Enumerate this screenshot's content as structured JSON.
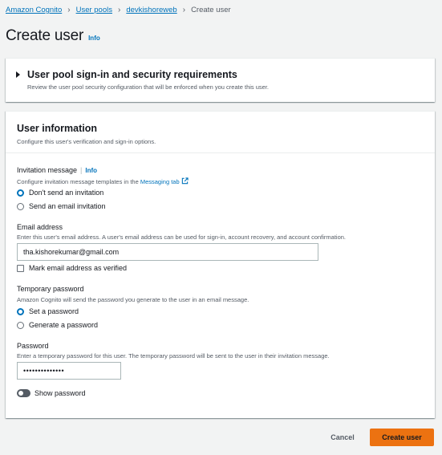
{
  "breadcrumb": {
    "items": [
      "Amazon Cognito",
      "User pools",
      "devkishoreweb"
    ],
    "current": "Create user"
  },
  "page": {
    "title": "Create user",
    "info": "Info"
  },
  "security_section": {
    "title": "User pool sign-in and security requirements",
    "description": "Review the user pool security configuration that will be enforced when you create this user."
  },
  "user_info": {
    "title": "User information",
    "description": "Configure this user's verification and sign-in options.",
    "invitation": {
      "label": "Invitation message",
      "info": "Info",
      "desc_prefix": "Configure invitation message templates in the ",
      "desc_link": "Messaging tab",
      "options": [
        "Don't send an invitation",
        "Send an email invitation"
      ],
      "selected": 0
    },
    "email": {
      "label": "Email address",
      "desc": "Enter this user's email address. A user's email address can be used for sign-in, account recovery, and account confirmation.",
      "value": "tha.kishorekumar@gmail.com",
      "verified_label": "Mark email address as verified",
      "verified_checked": false
    },
    "temp_password": {
      "label": "Temporary password",
      "desc": "Amazon Cognito will send the password you generate to the user in an email message.",
      "options": [
        "Set a password",
        "Generate a password"
      ],
      "selected": 0
    },
    "password": {
      "label": "Password",
      "desc": "Enter a temporary password for this user. The temporary password will be sent to the user in their invitation message.",
      "value": "••••••••••••••",
      "show_label": "Show password",
      "show_checked": false
    }
  },
  "footer": {
    "cancel": "Cancel",
    "create": "Create user"
  },
  "colors": {
    "link": "#0073bb",
    "primary": "#ec7211",
    "background": "#f2f3f3"
  }
}
